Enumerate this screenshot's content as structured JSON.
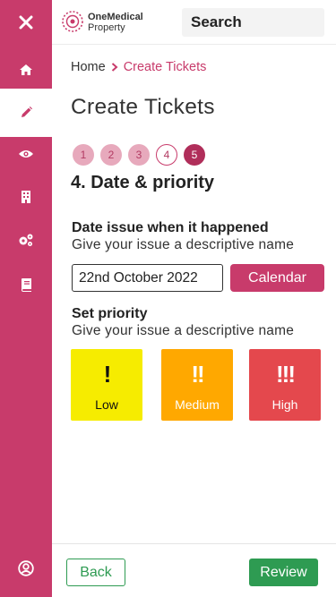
{
  "brand": {
    "logo_line1": "OneMedical",
    "logo_line2": "Property",
    "accent": "#c83b6b"
  },
  "sidebar": {
    "items": [
      {
        "icon": "close-icon"
      },
      {
        "icon": "home-icon"
      },
      {
        "icon": "pencil-icon",
        "active": true
      },
      {
        "icon": "eye-icon"
      },
      {
        "icon": "building-icon"
      },
      {
        "icon": "cogs-icon"
      },
      {
        "icon": "book-icon"
      },
      {
        "icon": "user-circle-icon"
      }
    ]
  },
  "header": {
    "search_label": "Search"
  },
  "breadcrumb": {
    "home": "Home",
    "current": "Create Tickets"
  },
  "page": {
    "title": "Create Tickets"
  },
  "steps": [
    "1",
    "2",
    "3",
    "4",
    "5"
  ],
  "section": {
    "title": "4. Date & priority"
  },
  "date_field": {
    "label": "Date issue when it happened",
    "help": "Give your issue a descriptive name",
    "value": "22nd October 2022",
    "calendar_label": "Calendar"
  },
  "priority": {
    "label": "Set priority",
    "help": "Give your issue a descriptive name",
    "options": [
      {
        "label": "Low",
        "marks": "!",
        "color": "#f6ec00"
      },
      {
        "label": "Medium",
        "marks": "!!",
        "color": "#ffa800"
      },
      {
        "label": "High",
        "marks": "!!!",
        "color": "#e4484d"
      }
    ]
  },
  "footer": {
    "back_label": "Back",
    "review_label": "Review",
    "button_color": "#2e9b52"
  }
}
